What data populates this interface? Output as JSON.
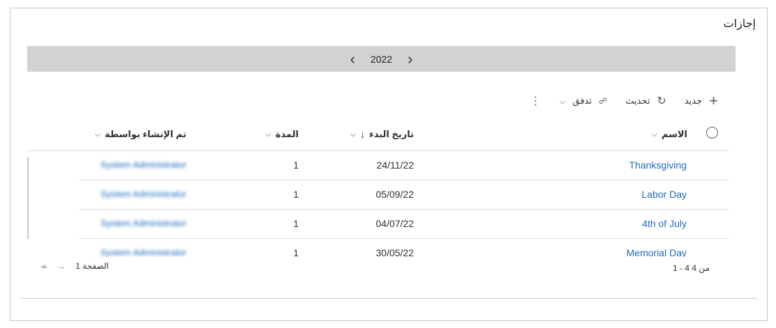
{
  "panel": {
    "title": "إجازات"
  },
  "year_nav": {
    "year": "2022"
  },
  "commands": {
    "new_label": "جديد",
    "refresh_label": "تحديث",
    "flow_label": "تدفق"
  },
  "columns": {
    "name": "الاسم",
    "start_date": "تاريخ البدء",
    "duration": "المدة",
    "created_by": "تم الإنشاء بواسطة"
  },
  "rows": [
    {
      "name": "Thanksgiving",
      "start_date": "24/11/22",
      "duration": "1",
      "created_by": "System Administrator"
    },
    {
      "name": "Labor Day",
      "start_date": "05/09/22",
      "duration": "1",
      "created_by": "System Administrator"
    },
    {
      "name": "4th of July",
      "start_date": "04/07/22",
      "duration": "1",
      "created_by": "System Administrator"
    },
    {
      "name": "Memorial Day",
      "start_date": "30/05/22",
      "duration": "1",
      "created_by": "System Administrator"
    }
  ],
  "footer": {
    "count_text": "1 - 4 من 4",
    "page_text": "الصفحة 1"
  },
  "icons": {
    "plus": "plus-icon",
    "refresh": "refresh-icon",
    "flow": "flow-icon",
    "more": "more-icon"
  },
  "colors": {
    "link": "#1e6cbf",
    "bar": "#d2d2d2"
  }
}
